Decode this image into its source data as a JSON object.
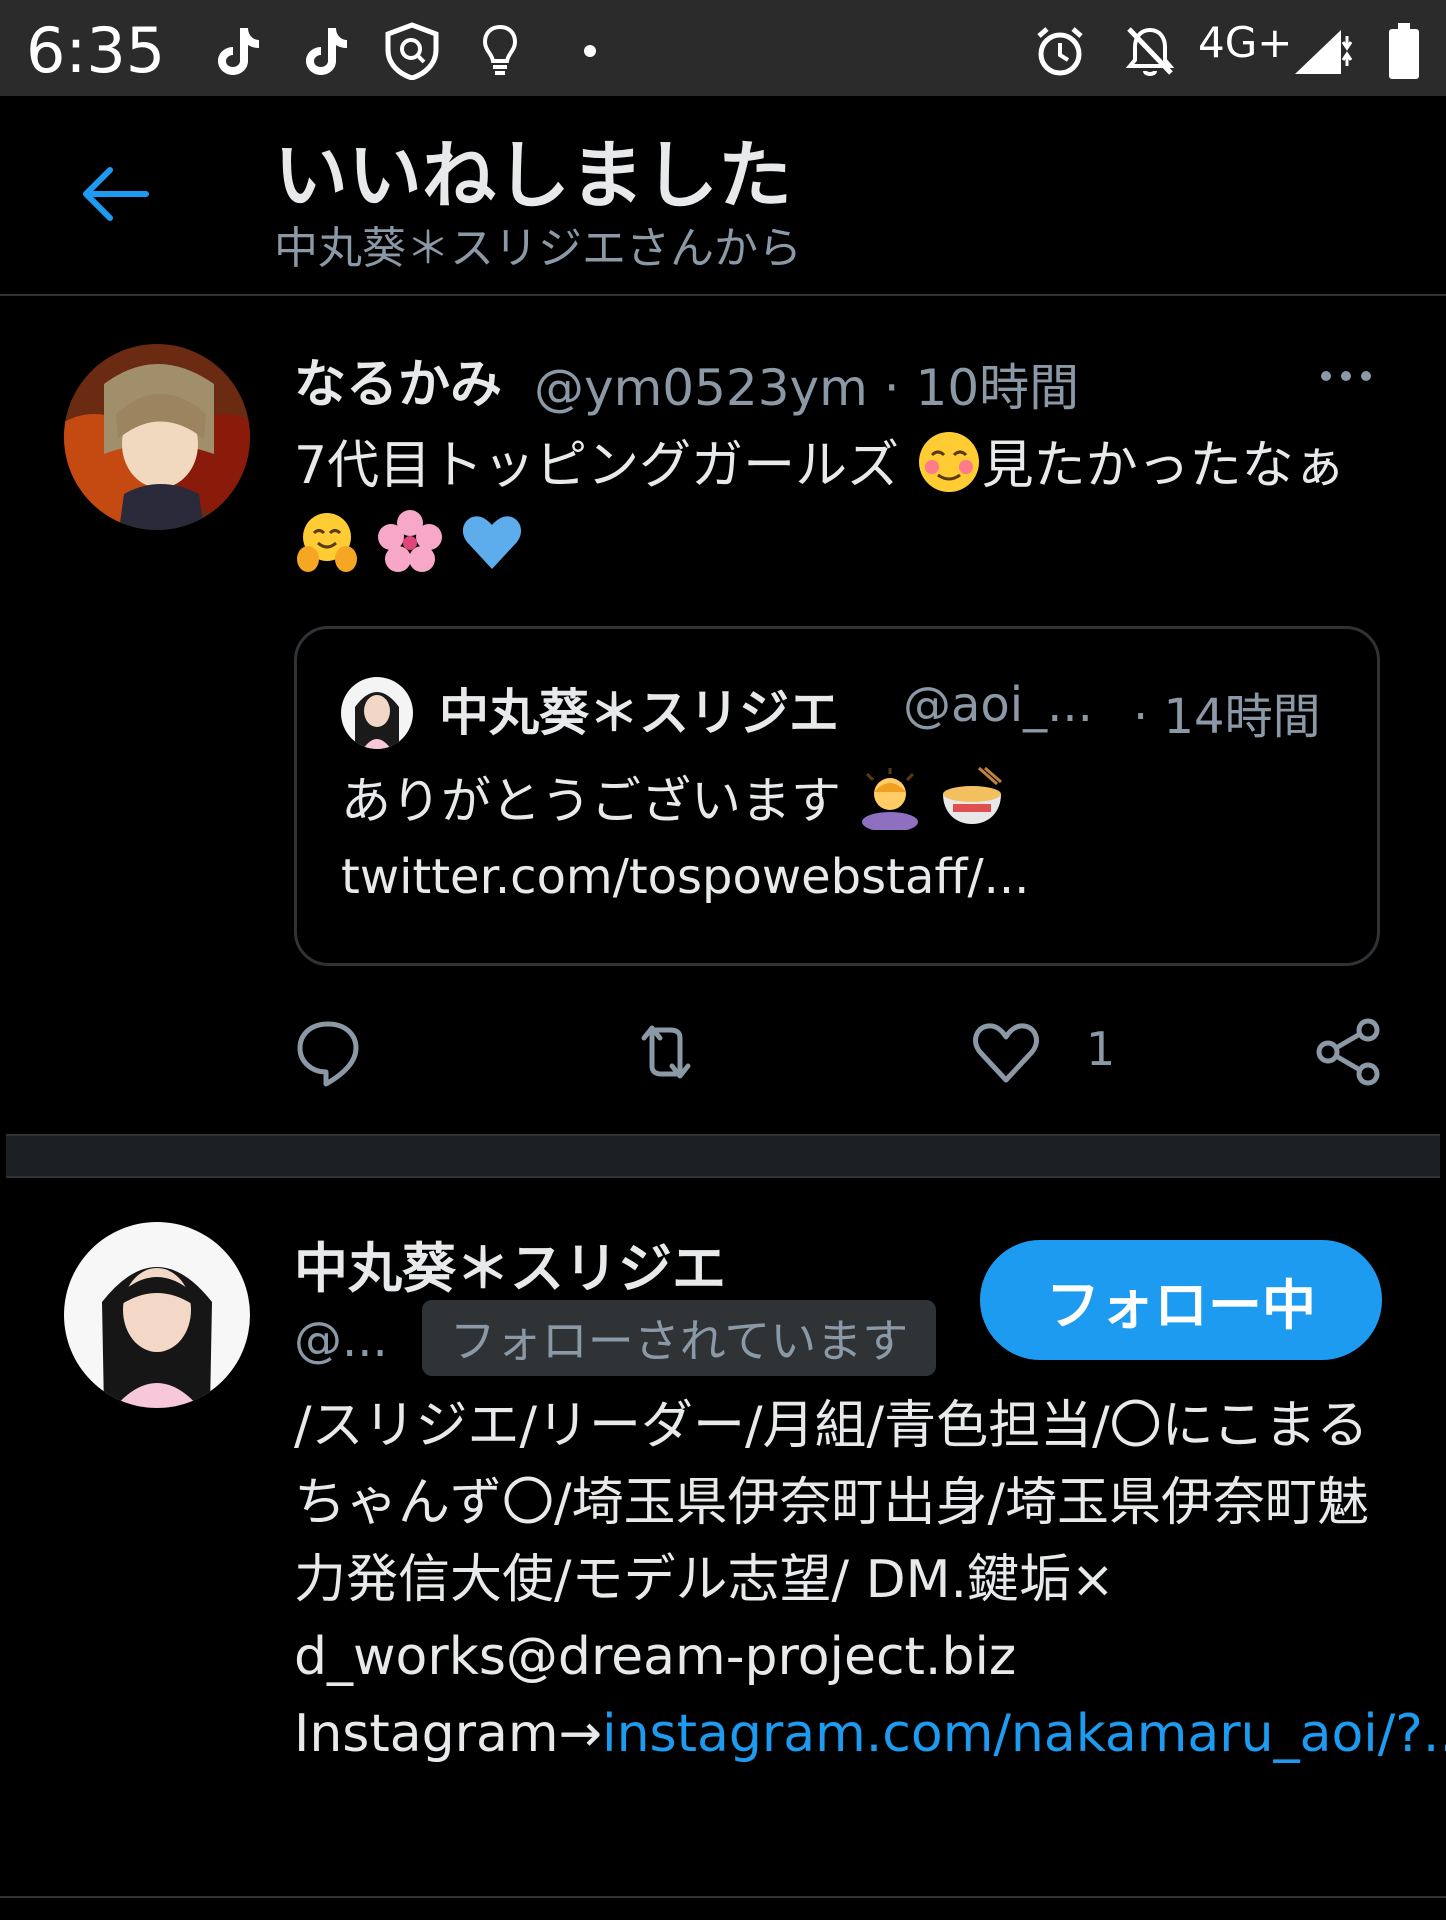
{
  "status_bar": {
    "time": "6:35",
    "left_icons": [
      "tiktok-icon",
      "tiktok-icon",
      "shield-icon",
      "lightbulb-icon",
      "dot-icon"
    ],
    "right_icons": [
      "alarm-icon",
      "notifications-off-icon",
      "signal-icon",
      "battery-icon"
    ],
    "network": "4G+"
  },
  "header": {
    "title": "いいねしました",
    "subtitle": "中丸葵＊スリジエさんから",
    "back_icon": "back-arrow-icon"
  },
  "tweet": {
    "author_name": "なるかみ",
    "author_handle": "@ym0523ym",
    "time": "10時間",
    "text_part1": "7代目トッピングガールズ",
    "text_part2": "見たかったなぁ",
    "emojis": [
      "smiling-blush-emoji",
      "hugging-face-emoji",
      "cherry-blossom-emoji",
      "blue-heart-emoji"
    ],
    "quote": {
      "author_name": "中丸葵＊スリジエ",
      "author_handle": "@aoi_...",
      "time": "· 14時間",
      "text": "ありがとうございます",
      "emojis": [
        "person-bowing-emoji",
        "ramen-bowl-emoji"
      ],
      "link": "twitter.com/tospowebstaff/..."
    },
    "actions": {
      "reply_icon": "reply-icon",
      "retweet_icon": "retweet-icon",
      "like_icon": "heart-icon",
      "like_count": "1",
      "share_icon": "share-icon"
    }
  },
  "user_card": {
    "name": "中丸葵＊スリジエ",
    "handle": "@...",
    "follows_you_badge": "フォローされています",
    "follow_button": "フォロー中",
    "bio_text": "/スリジエ/リーダー/月組/青色担当/〇にこまるちゃんず〇/埼玉県伊奈町出身/埼玉県伊奈町魅力発信大使/モデル志望/ DM.鍵垢× d_works@dream-project.biz",
    "bio_instagram_prefix": "Instagram→",
    "bio_instagram_link": "instagram.com/nakamaru_aoi/?...",
    "colors": {
      "link": "#1d9bf0",
      "button_bg": "#1d9bf0"
    }
  }
}
